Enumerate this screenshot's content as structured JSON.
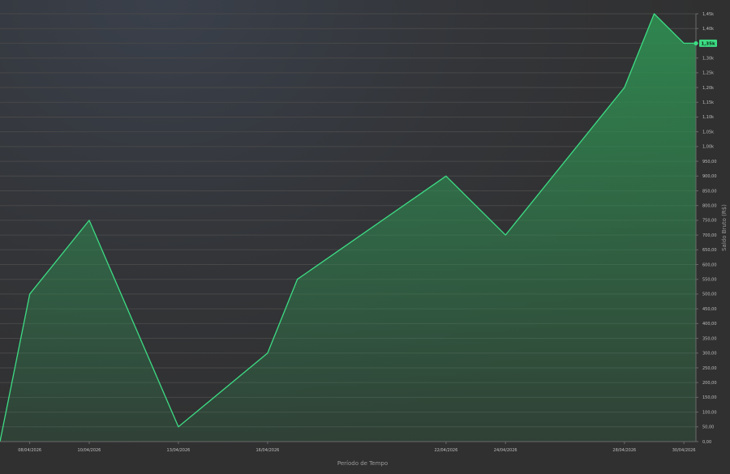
{
  "chart_data": {
    "type": "area",
    "xlabel": "Período de Tempo",
    "ylabel": "Saldo Bruto (R$)",
    "x_ticks": [
      "08/04/2026",
      "10/04/2026",
      "13/04/2026",
      "16/04/2026",
      "22/04/2026",
      "24/04/2026",
      "28/04/2026",
      "30/04/2026"
    ],
    "y_ticks": [
      "0,00",
      "50,00",
      "100,00",
      "150,00",
      "200,00",
      "250,00",
      "300,00",
      "350,00",
      "400,00",
      "450,00",
      "500,00",
      "550,00",
      "600,00",
      "650,00",
      "700,00",
      "750,00",
      "800,00",
      "850,00",
      "900,00",
      "950,00",
      "1,00k",
      "1,05k",
      "1,10k",
      "1,15k",
      "1,20k",
      "1,25k",
      "1,30k",
      "1,35k",
      "1,40k",
      "1,45k"
    ],
    "ylim": [
      0,
      1450
    ],
    "grid": true,
    "colors": {
      "line": "#3ddc84",
      "fill": "#2e7d4a",
      "label_bg": "#3ddc84"
    },
    "series": [
      {
        "x": [
          "07/04/2026",
          "08/04/2026",
          "10/04/2026",
          "13/04/2026",
          "16/04/2026",
          "17/04/2026",
          "22/04/2026",
          "23/04/2026",
          "24/04/2026",
          "28/04/2026",
          "29/04/2026",
          "30/04/2026",
          "30/04/2026"
        ],
        "y": [
          0,
          500,
          750,
          50,
          300,
          550,
          900,
          800,
          700,
          1200,
          1450,
          1350,
          1350
        ]
      }
    ],
    "last_value_label": "1,35k"
  }
}
